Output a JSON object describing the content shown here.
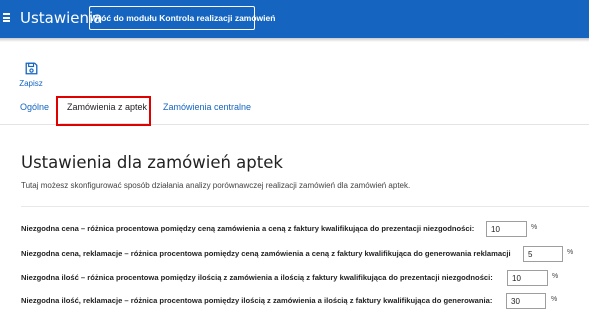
{
  "header": {
    "title": "Ustawienia",
    "back_button": "Wróć do modułu Kontrola realizacji zamówień"
  },
  "toolbar": {
    "save_label": "Zapisz"
  },
  "tabs": [
    {
      "label": "Ogólne",
      "active": false
    },
    {
      "label": "Zamówienia z aptek",
      "active": true
    },
    {
      "label": "Zamówienia centralne",
      "active": false
    }
  ],
  "section": {
    "title": "Ustawienia dla zamówień aptek",
    "description": "Tutaj możesz skonfigurować sposób działania analizy porównawczej realizacji zamówień dla zamówień aptek."
  },
  "settings": [
    {
      "label": "Niezgodna cena – różnica procentowa pomiędzy ceną zamówienia a ceną z faktury kwalifikująca do prezentacji niezgodności:",
      "value": "10",
      "unit": "%"
    },
    {
      "label": "Niezgodna cena, reklamacje – różnica procentowa pomiędzy ceną zamówienia a ceną z faktury kwalifikująca do generowania reklamacji",
      "value": "5",
      "unit": "%"
    },
    {
      "label": "Niezgodna ilość – różnica procentowa pomiędzy ilością z zamówienia a ilością z faktury kwalifikująca do prezentacji niezgodności:",
      "value": "10",
      "unit": "%"
    },
    {
      "label": "Niezgodna ilość, reklamacje – różnica procentowa pomiędzy ilością z zamówienia a ilością z faktury kwalifikująca do generowania:",
      "value": "30",
      "unit": "%"
    }
  ],
  "colors": {
    "topbar": "#1565c0",
    "accent": "#1565c0",
    "highlight": "#e00000"
  },
  "icons": {
    "menu": "hamburger-icon",
    "save": "floppy-disk-icon"
  }
}
